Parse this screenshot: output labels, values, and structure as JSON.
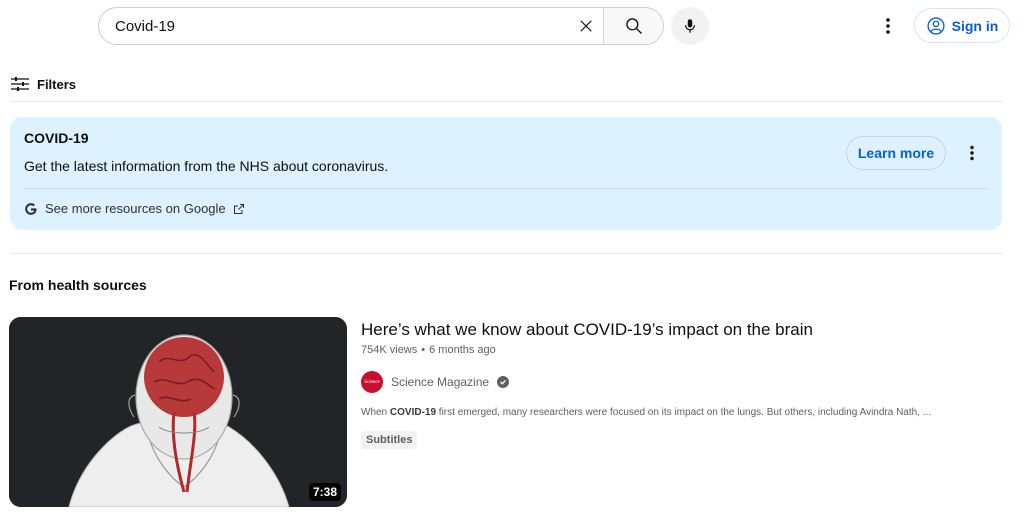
{
  "header": {
    "search_value": "Covid-19",
    "search_icon": "search-icon",
    "clear_icon": "close-icon",
    "mic_icon": "mic-icon",
    "more_icon": "more-vert-icon",
    "signin_label": "Sign in",
    "accent_color": "#065fd4"
  },
  "filters": {
    "label": "Filters"
  },
  "info_panel": {
    "title": "COVID-19",
    "body": "Get the latest information from the NHS about coronavirus.",
    "link_text": "See more resources on Google",
    "learn_more_label": "Learn more",
    "background_color": "#def1ff"
  },
  "section": {
    "heading": "From health sources"
  },
  "video": {
    "title": "Here’s what we know about COVID-19’s impact on the brain",
    "views": "754K views",
    "age": "6 months ago",
    "channel_name": "Science Magazine",
    "channel_avatar_text": "Science",
    "snippet_prefix": "When ",
    "snippet_bold": "COVID-19",
    "snippet_rest": " first emerged, many researchers were focused on its impact on the lungs. But others, including Avindra Nath, ...",
    "badge": "Subtitles",
    "duration": "7:38"
  }
}
